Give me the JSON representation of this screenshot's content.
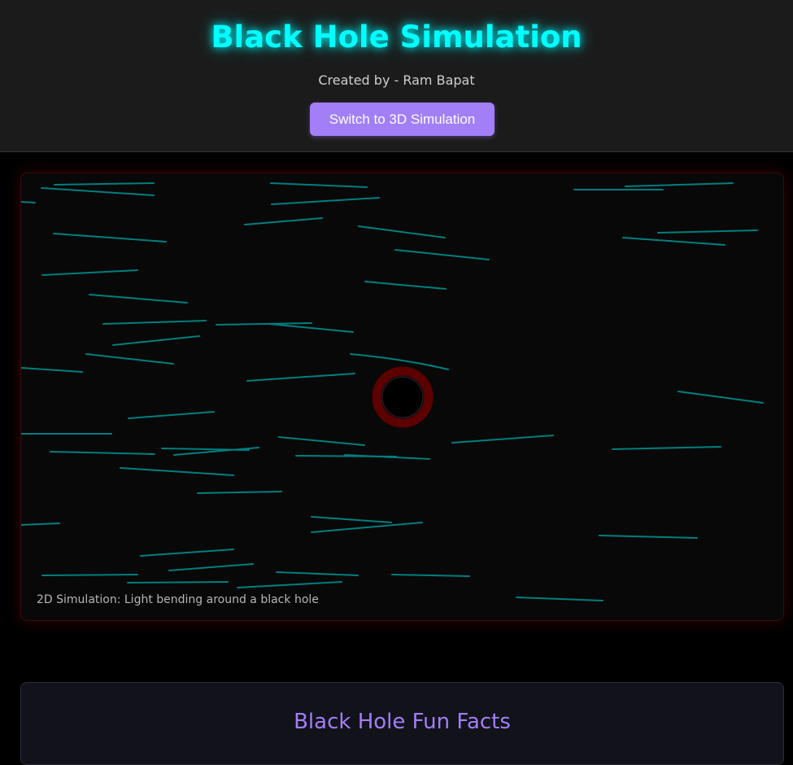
{
  "header": {
    "title": "Black Hole Simulation",
    "subtitle": "Created by - Ram Bapat",
    "switch_button_label": "Switch to 3D Simulation"
  },
  "simulation": {
    "caption": "2D Simulation: Light bending around a black hole",
    "colors": {
      "light_ray": "#008b8b",
      "event_horizon": "#000000",
      "photon_ring": "#5c0000",
      "panel_bg": "#080808"
    }
  },
  "facts": {
    "title": "Black Hole Fun Facts"
  },
  "colors": {
    "accent_cyan": "#00ffff",
    "accent_purple": "#a27ef7",
    "header_bg": "#1b1b1b"
  }
}
